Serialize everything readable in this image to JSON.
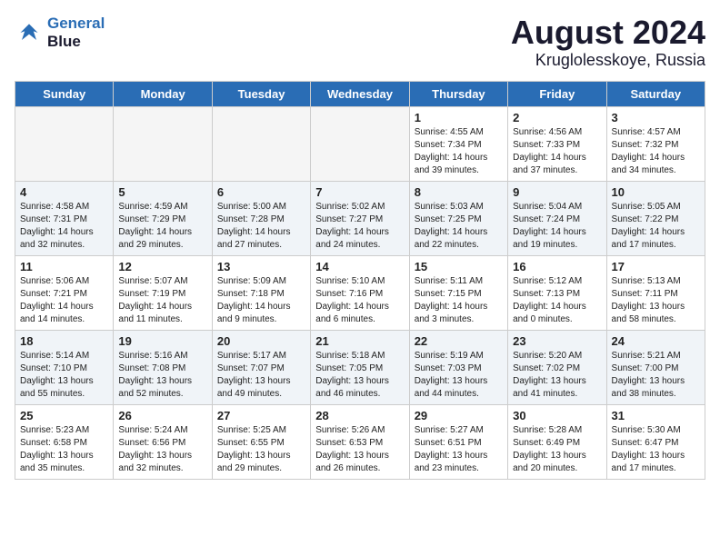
{
  "header": {
    "logo_line1": "General",
    "logo_line2": "Blue",
    "title": "August 2024",
    "subtitle": "Kruglolesskoye, Russia"
  },
  "days_of_week": [
    "Sunday",
    "Monday",
    "Tuesday",
    "Wednesday",
    "Thursday",
    "Friday",
    "Saturday"
  ],
  "weeks": [
    [
      {
        "day": "",
        "info": ""
      },
      {
        "day": "",
        "info": ""
      },
      {
        "day": "",
        "info": ""
      },
      {
        "day": "",
        "info": ""
      },
      {
        "day": "1",
        "info": "Sunrise: 4:55 AM\nSunset: 7:34 PM\nDaylight: 14 hours\nand 39 minutes."
      },
      {
        "day": "2",
        "info": "Sunrise: 4:56 AM\nSunset: 7:33 PM\nDaylight: 14 hours\nand 37 minutes."
      },
      {
        "day": "3",
        "info": "Sunrise: 4:57 AM\nSunset: 7:32 PM\nDaylight: 14 hours\nand 34 minutes."
      }
    ],
    [
      {
        "day": "4",
        "info": "Sunrise: 4:58 AM\nSunset: 7:31 PM\nDaylight: 14 hours\nand 32 minutes."
      },
      {
        "day": "5",
        "info": "Sunrise: 4:59 AM\nSunset: 7:29 PM\nDaylight: 14 hours\nand 29 minutes."
      },
      {
        "day": "6",
        "info": "Sunrise: 5:00 AM\nSunset: 7:28 PM\nDaylight: 14 hours\nand 27 minutes."
      },
      {
        "day": "7",
        "info": "Sunrise: 5:02 AM\nSunset: 7:27 PM\nDaylight: 14 hours\nand 24 minutes."
      },
      {
        "day": "8",
        "info": "Sunrise: 5:03 AM\nSunset: 7:25 PM\nDaylight: 14 hours\nand 22 minutes."
      },
      {
        "day": "9",
        "info": "Sunrise: 5:04 AM\nSunset: 7:24 PM\nDaylight: 14 hours\nand 19 minutes."
      },
      {
        "day": "10",
        "info": "Sunrise: 5:05 AM\nSunset: 7:22 PM\nDaylight: 14 hours\nand 17 minutes."
      }
    ],
    [
      {
        "day": "11",
        "info": "Sunrise: 5:06 AM\nSunset: 7:21 PM\nDaylight: 14 hours\nand 14 minutes."
      },
      {
        "day": "12",
        "info": "Sunrise: 5:07 AM\nSunset: 7:19 PM\nDaylight: 14 hours\nand 11 minutes."
      },
      {
        "day": "13",
        "info": "Sunrise: 5:09 AM\nSunset: 7:18 PM\nDaylight: 14 hours\nand 9 minutes."
      },
      {
        "day": "14",
        "info": "Sunrise: 5:10 AM\nSunset: 7:16 PM\nDaylight: 14 hours\nand 6 minutes."
      },
      {
        "day": "15",
        "info": "Sunrise: 5:11 AM\nSunset: 7:15 PM\nDaylight: 14 hours\nand 3 minutes."
      },
      {
        "day": "16",
        "info": "Sunrise: 5:12 AM\nSunset: 7:13 PM\nDaylight: 14 hours\nand 0 minutes."
      },
      {
        "day": "17",
        "info": "Sunrise: 5:13 AM\nSunset: 7:11 PM\nDaylight: 13 hours\nand 58 minutes."
      }
    ],
    [
      {
        "day": "18",
        "info": "Sunrise: 5:14 AM\nSunset: 7:10 PM\nDaylight: 13 hours\nand 55 minutes."
      },
      {
        "day": "19",
        "info": "Sunrise: 5:16 AM\nSunset: 7:08 PM\nDaylight: 13 hours\nand 52 minutes."
      },
      {
        "day": "20",
        "info": "Sunrise: 5:17 AM\nSunset: 7:07 PM\nDaylight: 13 hours\nand 49 minutes."
      },
      {
        "day": "21",
        "info": "Sunrise: 5:18 AM\nSunset: 7:05 PM\nDaylight: 13 hours\nand 46 minutes."
      },
      {
        "day": "22",
        "info": "Sunrise: 5:19 AM\nSunset: 7:03 PM\nDaylight: 13 hours\nand 44 minutes."
      },
      {
        "day": "23",
        "info": "Sunrise: 5:20 AM\nSunset: 7:02 PM\nDaylight: 13 hours\nand 41 minutes."
      },
      {
        "day": "24",
        "info": "Sunrise: 5:21 AM\nSunset: 7:00 PM\nDaylight: 13 hours\nand 38 minutes."
      }
    ],
    [
      {
        "day": "25",
        "info": "Sunrise: 5:23 AM\nSunset: 6:58 PM\nDaylight: 13 hours\nand 35 minutes."
      },
      {
        "day": "26",
        "info": "Sunrise: 5:24 AM\nSunset: 6:56 PM\nDaylight: 13 hours\nand 32 minutes."
      },
      {
        "day": "27",
        "info": "Sunrise: 5:25 AM\nSunset: 6:55 PM\nDaylight: 13 hours\nand 29 minutes."
      },
      {
        "day": "28",
        "info": "Sunrise: 5:26 AM\nSunset: 6:53 PM\nDaylight: 13 hours\nand 26 minutes."
      },
      {
        "day": "29",
        "info": "Sunrise: 5:27 AM\nSunset: 6:51 PM\nDaylight: 13 hours\nand 23 minutes."
      },
      {
        "day": "30",
        "info": "Sunrise: 5:28 AM\nSunset: 6:49 PM\nDaylight: 13 hours\nand 20 minutes."
      },
      {
        "day": "31",
        "info": "Sunrise: 5:30 AM\nSunset: 6:47 PM\nDaylight: 13 hours\nand 17 minutes."
      }
    ]
  ]
}
